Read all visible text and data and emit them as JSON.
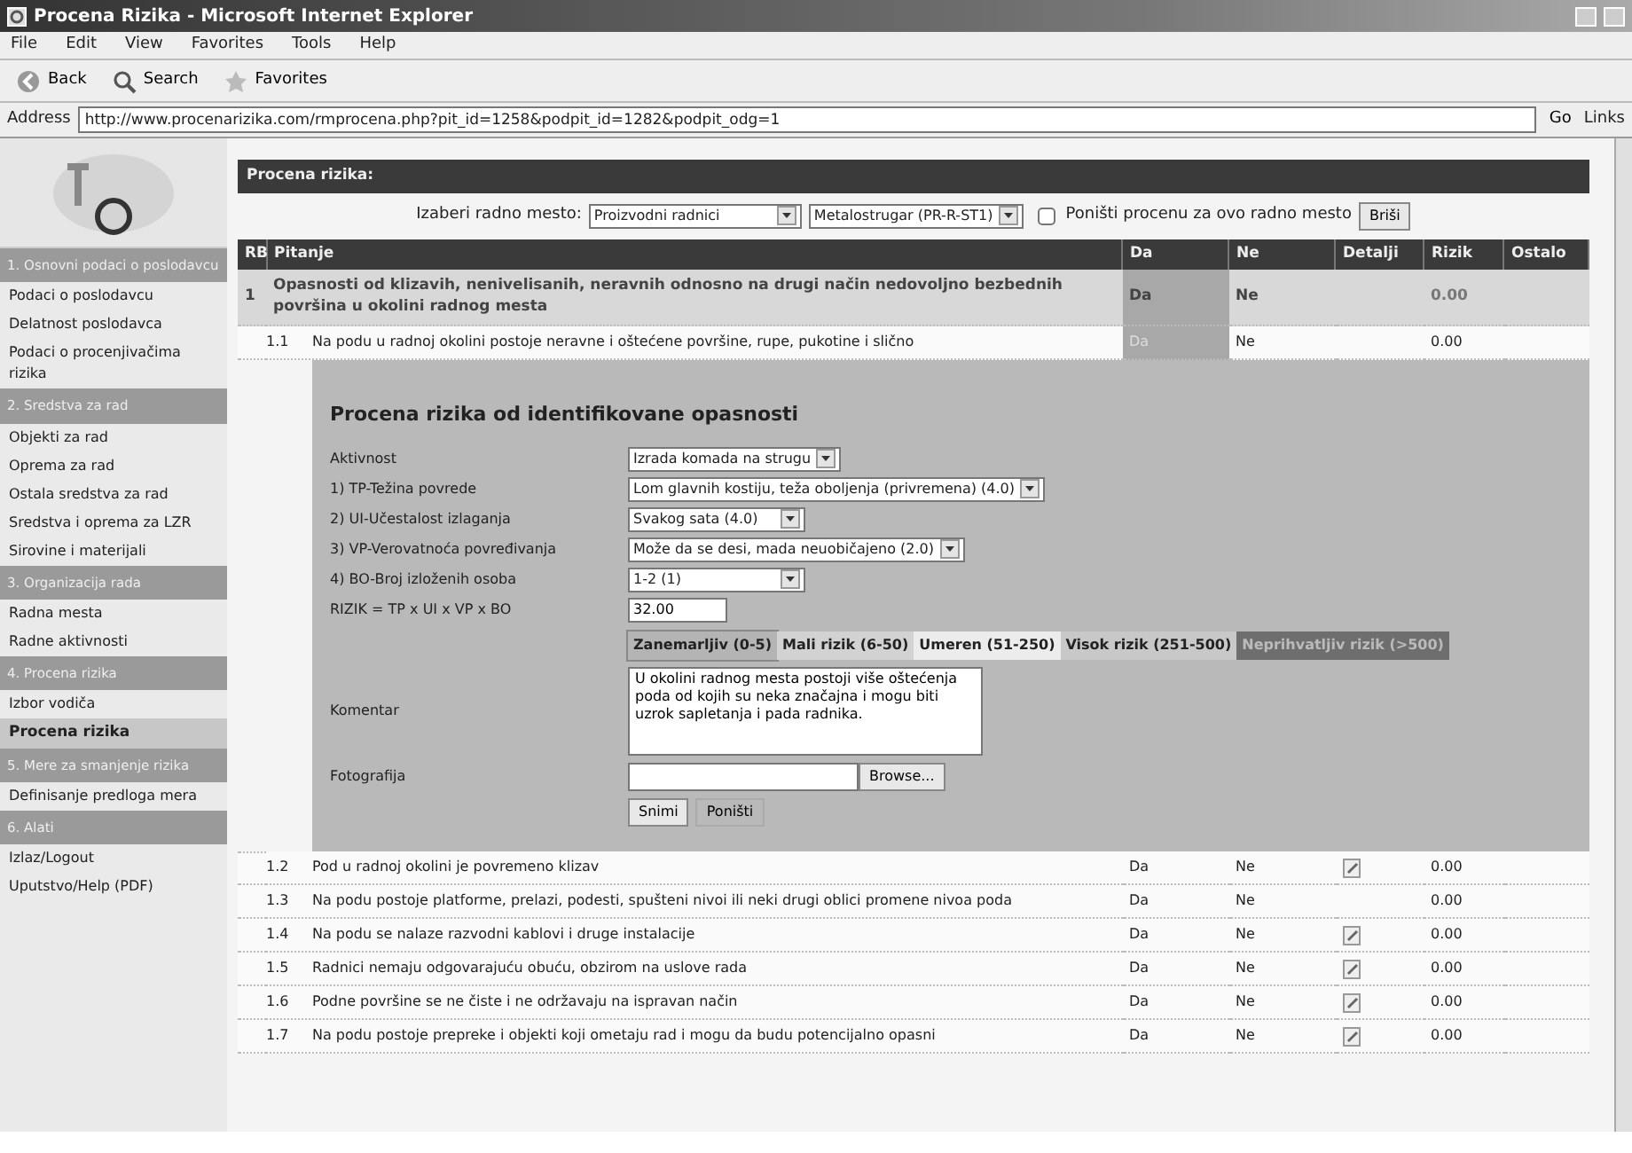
{
  "window": {
    "title": "Procena Rizika - Microsoft Internet Explorer"
  },
  "menu": [
    "File",
    "Edit",
    "View",
    "Favorites",
    "Tools",
    "Help"
  ],
  "toolbar": [
    {
      "kind": "back",
      "label": "Back"
    },
    {
      "kind": "search",
      "label": "Search"
    },
    {
      "kind": "favorites",
      "label": "Favorites"
    }
  ],
  "address": {
    "label": "Address",
    "url": "http://www.procenarizika.com/rmprocena.php?pit_id=1258&podpit_id=1282&podpit_odg=1",
    "go": "Go",
    "links": "Links"
  },
  "sidebar": [
    {
      "title": "1. Osnovni podaci o poslodavcu",
      "items": [
        {
          "label": "Podaci o poslodavcu",
          "selected": false
        },
        {
          "label": "Delatnost poslodavca",
          "selected": false
        },
        {
          "label": "Podaci o procenjivačima rizika",
          "selected": false
        }
      ]
    },
    {
      "title": "2. Sredstva za rad",
      "items": [
        {
          "label": "Objekti za rad",
          "selected": false
        },
        {
          "label": "Oprema za rad",
          "selected": false
        },
        {
          "label": "Ostala sredstva za rad",
          "selected": false
        },
        {
          "label": "Sredstva i oprema za LZR",
          "selected": false
        },
        {
          "label": "Sirovine i materijali",
          "selected": false
        }
      ]
    },
    {
      "title": "3. Organizacija rada",
      "items": [
        {
          "label": "Radna mesta",
          "selected": false
        },
        {
          "label": "Radne aktivnosti",
          "selected": false
        }
      ]
    },
    {
      "title": "4. Procena rizika",
      "items": [
        {
          "label": "Izbor vodiča",
          "selected": false
        },
        {
          "label": "Procena rizika",
          "selected": true
        }
      ]
    },
    {
      "title": "5. Mere za smanjenje rizika",
      "items": [
        {
          "label": "Definisanje predloga mera",
          "selected": false
        }
      ]
    },
    {
      "title": "6. Alati",
      "items": [
        {
          "label": "Izlaz/Logout",
          "selected": false
        },
        {
          "label": "Uputstvo/Help (PDF)",
          "selected": false
        }
      ]
    }
  ],
  "page_title": "Procena rizika:",
  "selector": {
    "label": "Izaberi radno mesto:",
    "workplace": "Proizvodni radnici",
    "position": "Metalostrugar (PR-R-ST1)",
    "reset_label": "Poništi procenu za ovo radno mesto",
    "reset_checked": false,
    "delete": "Briši"
  },
  "table": {
    "columns": [
      "RB",
      "Pitanje",
      "Da",
      "Ne",
      "Detalji",
      "Rizik",
      "Ostalo"
    ],
    "group": {
      "number": "1",
      "text": "Opasnosti od klizavih, nenivelisanih, neravnih odnosno na drugi način nedovoljno bezbednih površina u okolini radnog mesta",
      "da": "Da",
      "ne": "Ne",
      "da_selected": true,
      "risk": "0.00"
    },
    "rows": [
      {
        "number": "1.1",
        "text": "Na podu u radnoj okolini postoje neravne i oštećene površine, rupe, pukotine i slično",
        "da": "Da",
        "ne": "Ne",
        "da_selected": true,
        "has_details": false,
        "risk": "0.00"
      }
    ],
    "rows_after": [
      {
        "number": "1.2",
        "text": "Pod u radnoj okolini je povremeno klizav",
        "da": "Da",
        "ne": "Ne",
        "da_selected": false,
        "has_details": true,
        "risk": "0.00"
      },
      {
        "number": "1.3",
        "text": "Na podu postoje platforme, prelazi, podesti, spušteni nivoi ili neki drugi oblici promene nivoa poda",
        "da": "Da",
        "ne": "Ne",
        "da_selected": false,
        "has_details": false,
        "risk": "0.00"
      },
      {
        "number": "1.4",
        "text": "Na podu se nalaze razvodni kablovi i druge instalacije",
        "da": "Da",
        "ne": "Ne",
        "da_selected": false,
        "has_details": true,
        "risk": "0.00"
      },
      {
        "number": "1.5",
        "text": "Radnici nemaju odgovarajuću obuću, obzirom na uslove rada",
        "da": "Da",
        "ne": "Ne",
        "da_selected": false,
        "has_details": true,
        "risk": "0.00"
      },
      {
        "number": "1.6",
        "text": "Podne površine se ne čiste i ne održavaju na ispravan način",
        "da": "Da",
        "ne": "Ne",
        "da_selected": false,
        "has_details": true,
        "risk": "0.00"
      },
      {
        "number": "1.7",
        "text": "Na podu postoje prepreke i objekti koji ometaju rad i mogu da budu potencijalno opasni",
        "da": "Da",
        "ne": "Ne",
        "da_selected": false,
        "has_details": true,
        "risk": "0.00"
      }
    ]
  },
  "assessment": {
    "title": "Procena rizika od identifikovane opasnosti",
    "fields": [
      {
        "label": "Aktivnost",
        "value": "Izrada komada na strugu",
        "kind": "select"
      },
      {
        "label": "1) TP-Težina povrede",
        "value": "Lom glavnih kostiju, teža oboljenja (privremena) (4.0)",
        "kind": "select"
      },
      {
        "label": "2) UI-Učestalost izlaganja",
        "value": "Svakog sata (4.0)",
        "kind": "select"
      },
      {
        "label": "3) VP-Verovatnoća povređivanja",
        "value": "Može da se desi, mada neuobičajeno (2.0)",
        "kind": "select"
      },
      {
        "label": "4) BO-Broj izloženih osoba",
        "value": "1-2 (1)",
        "kind": "select"
      },
      {
        "label": "RIZIK = TP x UI x VP x BO",
        "value": "32.00",
        "kind": "text"
      }
    ],
    "levels": [
      {
        "label": "Zanemarljiv (0-5)",
        "color": "#b4b4b4",
        "selected": true
      },
      {
        "label": "Mali rizik (6-50)",
        "color": "#d2d2d2",
        "selected": false
      },
      {
        "label": "Umeren (51-250)",
        "color": "#ececec",
        "selected": false
      },
      {
        "label": "Visok rizik (251-500)",
        "color": "#c8c8c8",
        "selected": false
      },
      {
        "label": "Neprihvatljiv rizik (>500)",
        "color": "#6e6e6e",
        "selected": false
      }
    ],
    "comment_label": "Komentar",
    "comment": "U okolini radnog mesta postoji više oštećenja poda od kojih su neka značajna i mogu biti uzrok sapletanja i pada radnika.",
    "photo_label": "Fotografija",
    "browse": "Browse...",
    "save": "Snimi",
    "cancel": "Poništi"
  }
}
